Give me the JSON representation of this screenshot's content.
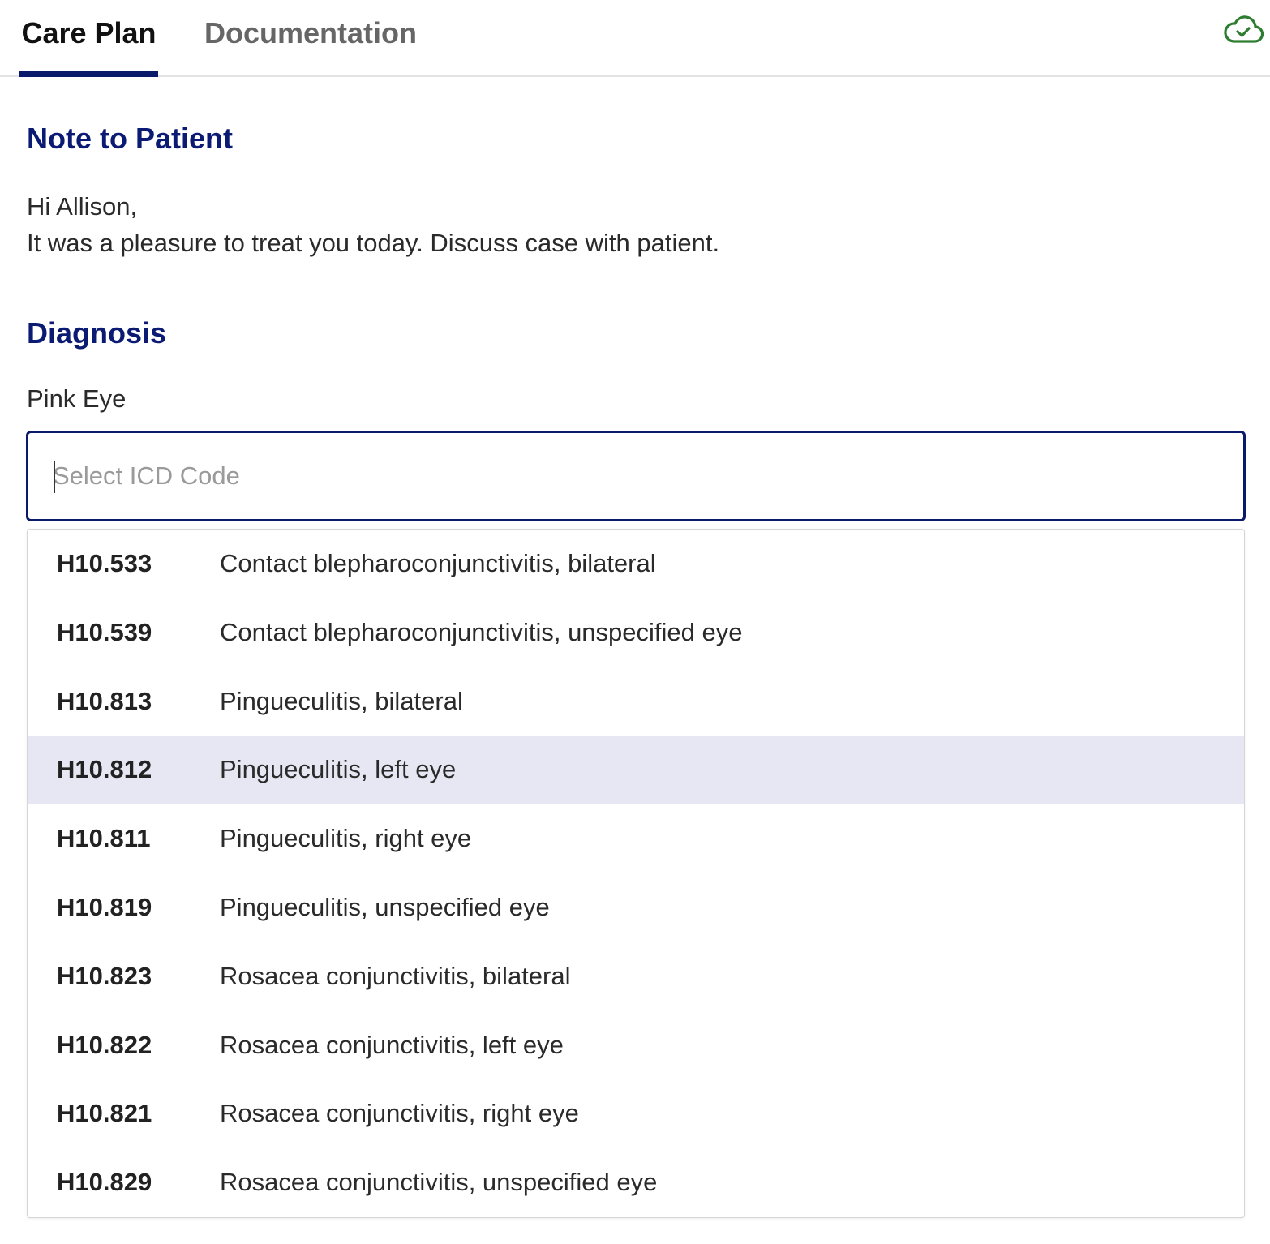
{
  "tabs": [
    {
      "label": "Care Plan",
      "active": true
    },
    {
      "label": "Documentation",
      "active": false
    }
  ],
  "sync_status": {
    "icon": "cloud-check-icon",
    "color": "#2e7d32"
  },
  "note": {
    "heading": "Note to Patient",
    "greeting": "Hi Allison,",
    "body": "It was a pleasure to treat you today. Discuss case with patient."
  },
  "diagnosis": {
    "heading": "Diagnosis",
    "name": "Pink Eye",
    "input": {
      "placeholder": "Select ICD Code",
      "value": ""
    }
  },
  "icd_options": [
    {
      "code": "H10.533",
      "description": "Contact blepharoconjunctivitis, bilateral",
      "highlighted": false
    },
    {
      "code": "H10.539",
      "description": "Contact blepharoconjunctivitis, unspecified eye",
      "highlighted": false
    },
    {
      "code": "H10.813",
      "description": "Pingueculitis, bilateral",
      "highlighted": false
    },
    {
      "code": "H10.812",
      "description": "Pingueculitis, left eye",
      "highlighted": true
    },
    {
      "code": "H10.811",
      "description": "Pingueculitis, right eye",
      "highlighted": false
    },
    {
      "code": "H10.819",
      "description": "Pingueculitis, unspecified eye",
      "highlighted": false
    },
    {
      "code": "H10.823",
      "description": "Rosacea conjunctivitis, bilateral",
      "highlighted": false
    },
    {
      "code": "H10.822",
      "description": "Rosacea conjunctivitis, left eye",
      "highlighted": false
    },
    {
      "code": "H10.821",
      "description": "Rosacea conjunctivitis, right eye",
      "highlighted": false
    },
    {
      "code": "H10.829",
      "description": "Rosacea conjunctivitis, unspecified eye",
      "highlighted": false
    }
  ],
  "colors": {
    "accent": "#0a1a6b",
    "heading": "#0b1a73",
    "highlight_row": "#e6e7f2"
  }
}
